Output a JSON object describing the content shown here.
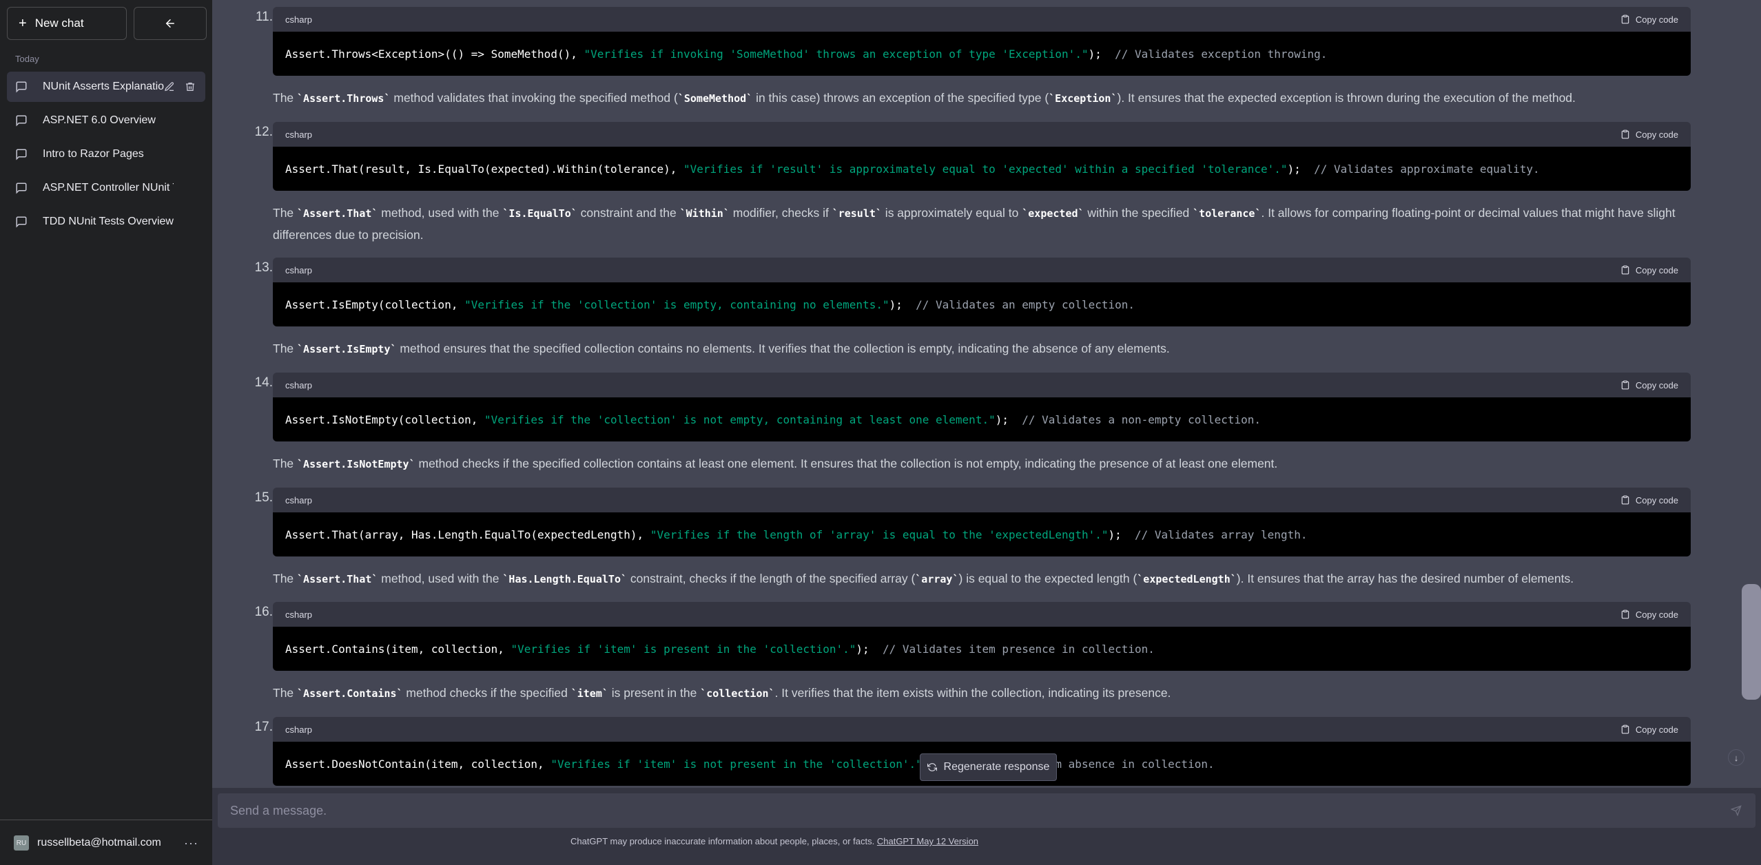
{
  "sidebar": {
    "new_chat": "New chat",
    "section_today": "Today",
    "chats": [
      {
        "label": "NUnit Asserts Explanatio"
      },
      {
        "label": "ASP.NET 6.0 Overview"
      },
      {
        "label": "Intro to Razor Pages"
      },
      {
        "label": "ASP.NET Controller NUnit Test"
      },
      {
        "label": "TDD NUnit Tests Overview"
      }
    ],
    "user": {
      "initials": "RU",
      "email": "russellbeta@hotmail.com"
    }
  },
  "items": [
    {
      "num": "11.",
      "lang": "csharp",
      "copy": "Copy code",
      "code": [
        "Assert.Throws<Exception>(() => SomeMethod(), ",
        "\"Verifies if invoking 'SomeMethod' throws an exception of type 'Exception'.\"",
        ");  ",
        "// Validates exception throwing."
      ],
      "desc": [
        "The ",
        "`Assert.Throws`",
        " method validates that invoking the specified method (",
        "`SomeMethod`",
        " in this case) throws an exception of the specified type (",
        "`Exception`",
        "). It ensures that the expected exception is thrown during the execution of the method."
      ]
    },
    {
      "num": "12.",
      "lang": "csharp",
      "copy": "Copy code",
      "code": [
        "Assert.That(result, Is.EqualTo(expected).Within(tolerance), ",
        "\"Verifies if 'result' is approximately equal to 'expected' within a specified 'tolerance'.\"",
        ");  ",
        "// Validates approximate equality."
      ],
      "desc": [
        "The ",
        "`Assert.That`",
        " method, used with the ",
        "`Is.EqualTo`",
        " constraint and the ",
        "`Within`",
        " modifier, checks if ",
        "`result`",
        " is approximately equal to ",
        "`expected`",
        " within the specified ",
        "`tolerance`",
        ". It allows for comparing floating-point or decimal values that might have slight differences due to precision."
      ]
    },
    {
      "num": "13.",
      "lang": "csharp",
      "copy": "Copy code",
      "code": [
        "Assert.IsEmpty(collection, ",
        "\"Verifies if the 'collection' is empty, containing no elements.\"",
        ");  ",
        "// Validates an empty collection."
      ],
      "desc": [
        "The ",
        "`Assert.IsEmpty`",
        " method ensures that the specified collection contains no elements. It verifies that the collection is empty, indicating the absence of any elements."
      ]
    },
    {
      "num": "14.",
      "lang": "csharp",
      "copy": "Copy code",
      "code": [
        "Assert.IsNotEmpty(collection, ",
        "\"Verifies if the 'collection' is not empty, containing at least one element.\"",
        ");  ",
        "// Validates a non-empty collection."
      ],
      "desc": [
        "The ",
        "`Assert.IsNotEmpty`",
        " method checks if the specified collection contains at least one element. It ensures that the collection is not empty, indicating the presence of at least one element."
      ]
    },
    {
      "num": "15.",
      "lang": "csharp",
      "copy": "Copy code",
      "code": [
        "Assert.That(array, Has.Length.EqualTo(expectedLength), ",
        "\"Verifies if the length of 'array' is equal to the 'expectedLength'.\"",
        ");  ",
        "// Validates array length."
      ],
      "desc": [
        "The ",
        "`Assert.That`",
        " method, used with the ",
        "`Has.Length.EqualTo`",
        " constraint, checks if the length of the specified array (",
        "`array`",
        ") is equal to the expected length (",
        "`expectedLength`",
        "). It ensures that the array has the desired number of elements."
      ]
    },
    {
      "num": "16.",
      "lang": "csharp",
      "copy": "Copy code",
      "code": [
        "Assert.Contains(item, collection, ",
        "\"Verifies if 'item' is present in the 'collection'.\"",
        ");  ",
        "// Validates item presence in collection."
      ],
      "desc": [
        "The ",
        "`Assert.Contains`",
        " method checks if the specified ",
        "`item`",
        " is present in the ",
        "`collection`",
        ". It verifies that the item exists within the collection, indicating its presence."
      ]
    },
    {
      "num": "17.",
      "lang": "csharp",
      "copy": "Copy code",
      "code": [
        "Assert.DoesNotContain(item, collection, ",
        "\"Verifies if 'item' is not present in the 'collection'.\"",
        ");  ",
        "// Validates item absence in collection."
      ],
      "desc": []
    }
  ],
  "regenerate": "Regenerate response",
  "composer": {
    "placeholder": "Send a message."
  },
  "footer": {
    "text": "ChatGPT may produce inaccurate information about people, places, or facts. ",
    "link": "ChatGPT May 12 Version"
  }
}
